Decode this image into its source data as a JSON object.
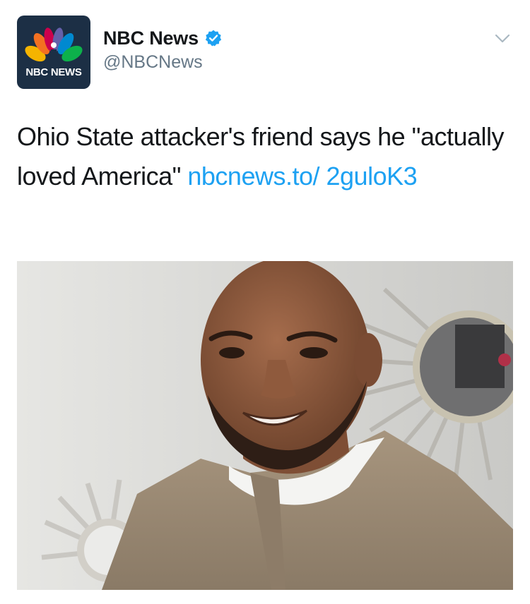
{
  "account": {
    "avatar_text": "NBC NEWS",
    "display_name": "NBC News",
    "handle": "@NBCNews",
    "verified": true
  },
  "tweet": {
    "text": "Ohio State attacker's friend says he \"actually loved America\" ",
    "link": "nbcnews.to/ 2guloK3"
  },
  "media": {
    "description_icon": "photo"
  },
  "colors": {
    "link": "#1da1f2",
    "secondary_text": "#657786",
    "primary_text": "#14171a",
    "verified_blue": "#1da1f2",
    "avatar_bg": "#1c2f45"
  },
  "icons": {
    "caret": "chevron-down-icon",
    "verified": "verified-badge-icon",
    "logo": "nbc-peacock-icon"
  }
}
